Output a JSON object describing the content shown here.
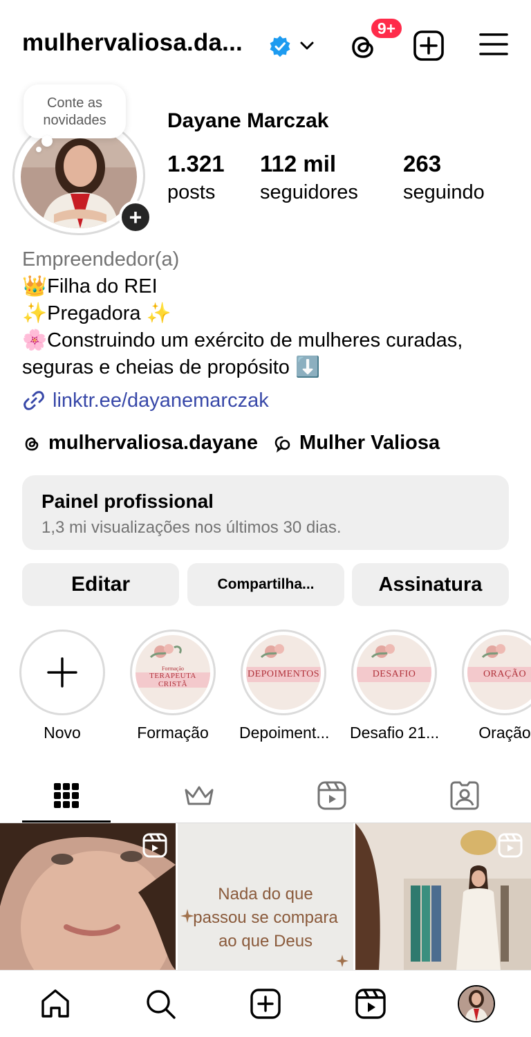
{
  "header": {
    "username": "mulhervaliosa.da...",
    "notification_badge": "9+",
    "icons": [
      "verified-badge-icon",
      "chevron-down-icon",
      "threads-icon",
      "plus-square-icon",
      "hamburger-menu-icon"
    ]
  },
  "profile": {
    "note": "Conte as novidades",
    "display_name": "Dayane Marczak",
    "stats": [
      {
        "value": "1.321",
        "label": "posts"
      },
      {
        "value": "112 mil",
        "label": "seguidores"
      },
      {
        "value": "263",
        "label": "seguindo"
      }
    ],
    "category": "Empreendedor(a)",
    "bio_lines": [
      "👑Filha do REI",
      "✨Pregadora ✨",
      "🌸Construindo um exército de mulheres curadas, seguras e cheias de propósito ⬇️"
    ],
    "link": "linktr.ee/dayanemarczak",
    "threads_handle": "mulhervaliosa.dayane",
    "channel_name": "Mulher Valiosa"
  },
  "dashboard": {
    "title": "Painel profissional",
    "subtitle": "1,3 mi visualizações nos últimos 30 dias."
  },
  "actions": {
    "edit": "Editar",
    "share": "Compartilha...",
    "subscription": "Assinatura"
  },
  "highlights": [
    {
      "label": "Novo",
      "cover": ""
    },
    {
      "label": "Formação",
      "cover": "TERAPEUTA CRISTÃ",
      "cover_small": "Formação"
    },
    {
      "label": "Depoiment...",
      "cover": "DEPOIMENTOS"
    },
    {
      "label": "Desafio 21...",
      "cover": "DESAFIO"
    },
    {
      "label": "Oração",
      "cover": "ORAÇÃO"
    }
  ],
  "tabs": [
    "grid-icon",
    "crown-icon",
    "reels-icon",
    "tagged-icon"
  ],
  "posts": [
    {
      "type": "reel",
      "caption": ""
    },
    {
      "type": "image",
      "caption": "Nada do que passou se compara ao que Deus"
    },
    {
      "type": "reel",
      "caption": ""
    }
  ],
  "colors": {
    "accent_link": "#3848a8",
    "badge_red": "#ff2b4a",
    "verified_blue": "#1d9bf0",
    "button_bg": "#efefef",
    "muted_text": "#737373"
  },
  "bottom_nav": [
    "home-icon",
    "search-icon",
    "create-icon",
    "reels-icon",
    "profile-avatar"
  ]
}
